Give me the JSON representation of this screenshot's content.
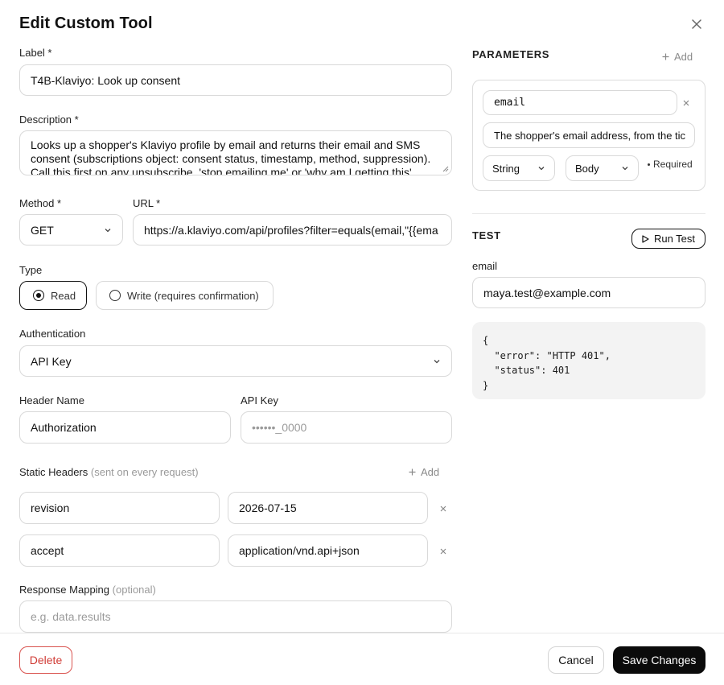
{
  "dialog": {
    "title": "Edit Custom Tool"
  },
  "form": {
    "label": {
      "label": "Label *",
      "value": "T4B-Klaviyo: Look up consent"
    },
    "description": {
      "label": "Description *",
      "lines": [
        "Looks up a shopper's Klaviyo profile by email and returns their email and SMS",
        "consent (subscriptions object: consent status, timestamp, method, suppression).",
        "Call this first on any unsubscribe, 'stop emailing me' or 'why am I getting this'"
      ]
    },
    "method": {
      "label": "Method *",
      "value": "GET"
    },
    "url": {
      "label": "URL *",
      "value": "https://a.klaviyo.com/api/profiles?filter=equals(email,\"{{ema"
    },
    "type": {
      "label": "Type",
      "options": [
        {
          "label": "Read",
          "selected": true
        },
        {
          "label": "Write (requires confirmation)",
          "selected": false
        }
      ]
    },
    "authentication": {
      "label": "Authentication",
      "value": "API Key"
    },
    "header_name": {
      "label": "Header Name",
      "value": "Authorization"
    },
    "api_key": {
      "label": "API Key",
      "placeholder": "••••••_0000"
    },
    "static_headers": {
      "label": "Static Headers",
      "hint": "(sent on every request)",
      "add_label": "Add",
      "rows": [
        {
          "key": "revision",
          "value": "2026-07-15"
        },
        {
          "key": "accept",
          "value": "application/vnd.api+json"
        }
      ]
    },
    "response_mapping": {
      "label": "Response Mapping",
      "hint": "(optional)",
      "placeholder": "e.g. data.results"
    }
  },
  "parameters": {
    "heading": "PARAMETERS",
    "add_label": "Add",
    "items": [
      {
        "name": "email",
        "description": "The shopper's email address, from the tic",
        "type": "String",
        "location": "Body",
        "required_label": "Required"
      }
    ]
  },
  "test": {
    "heading": "TEST",
    "run_label": "Run Test",
    "field_label": "email",
    "field_value": "maya.test@example.com",
    "output_lines": [
      "{",
      "  \"error\": \"HTTP 401\",",
      "  \"status\": 401",
      "}"
    ]
  },
  "footer": {
    "delete_label": "Delete",
    "cancel_label": "Cancel",
    "save_label": "Save Changes"
  },
  "colors": {
    "danger": "#d03b35",
    "primary": "#0b0b0b",
    "border": "#d9d9d9"
  },
  "icons": [
    "close-icon",
    "chevron-down-icon",
    "plus-icon",
    "remove-icon",
    "play-icon",
    "resize-grip-icon"
  ]
}
